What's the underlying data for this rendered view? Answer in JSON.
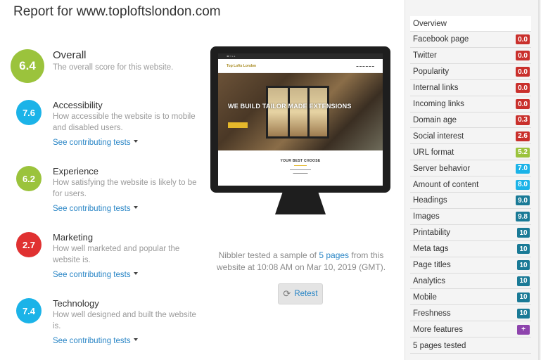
{
  "header": {
    "title": "Report for www.toploftslondon.com"
  },
  "scores": [
    {
      "value": "6.4",
      "title": "Overall",
      "description": "The overall score for this website.",
      "color": "#9bc33c"
    },
    {
      "value": "7.6",
      "title": "Accessibility",
      "description": "How accessible the website is to mobile and disabled users.",
      "link": "See contributing tests",
      "color": "#1bb3e8"
    },
    {
      "value": "6.2",
      "title": "Experience",
      "description": "How satisfying the website is likely to be for users.",
      "link": "See contributing tests",
      "color": "#9bc33c"
    },
    {
      "value": "2.7",
      "title": "Marketing",
      "description": "How well marketed and popular the website is.",
      "link": "See contributing tests",
      "color": "#e03131"
    },
    {
      "value": "7.4",
      "title": "Technology",
      "description": "How well designed and built the website is.",
      "link": "See contributing tests",
      "color": "#1bb3e8"
    }
  ],
  "preview": {
    "logo": "Top Lofts London",
    "hero_heading": "WE BUILD TAILOR MADE EXTENSIONS",
    "section_title": "YOUR BEST CHOOSE"
  },
  "sample": {
    "prefix": "Nibbler tested a sample of ",
    "link": "5 pages",
    "suffix": " from this website at 10:08 AM on Mar 10, 2019 (GMT)."
  },
  "retest": {
    "label": "Retest",
    "icon": "refresh-icon"
  },
  "sidebar": {
    "items": [
      {
        "label": "Overview",
        "score": "",
        "color": ""
      },
      {
        "label": "Facebook page",
        "score": "0.0",
        "color": "#c9302c"
      },
      {
        "label": "Twitter",
        "score": "0.0",
        "color": "#c9302c"
      },
      {
        "label": "Popularity",
        "score": "0.0",
        "color": "#c9302c"
      },
      {
        "label": "Internal links",
        "score": "0.0",
        "color": "#c9302c"
      },
      {
        "label": "Incoming links",
        "score": "0.0",
        "color": "#c9302c"
      },
      {
        "label": "Domain age",
        "score": "0.3",
        "color": "#c9302c"
      },
      {
        "label": "Social interest",
        "score": "2.6",
        "color": "#c9302c"
      },
      {
        "label": "URL format",
        "score": "5.2",
        "color": "#9bc33c"
      },
      {
        "label": "Server behavior",
        "score": "7.0",
        "color": "#1bb3e8"
      },
      {
        "label": "Amount of content",
        "score": "8.0",
        "color": "#1bb3e8"
      },
      {
        "label": "Headings",
        "score": "9.0",
        "color": "#1a7a96"
      },
      {
        "label": "Images",
        "score": "9.8",
        "color": "#1a7a96"
      },
      {
        "label": "Printability",
        "score": "10",
        "color": "#1a7a96"
      },
      {
        "label": "Meta tags",
        "score": "10",
        "color": "#1a7a96"
      },
      {
        "label": "Page titles",
        "score": "10",
        "color": "#1a7a96"
      },
      {
        "label": "Analytics",
        "score": "10",
        "color": "#1a7a96"
      },
      {
        "label": "Mobile",
        "score": "10",
        "color": "#1a7a96"
      },
      {
        "label": "Freshness",
        "score": "10",
        "color": "#1a7a96"
      },
      {
        "label": "More features",
        "score": "+",
        "color": "#8e44ad"
      },
      {
        "label": "5 pages tested",
        "score": "",
        "color": ""
      }
    ]
  }
}
